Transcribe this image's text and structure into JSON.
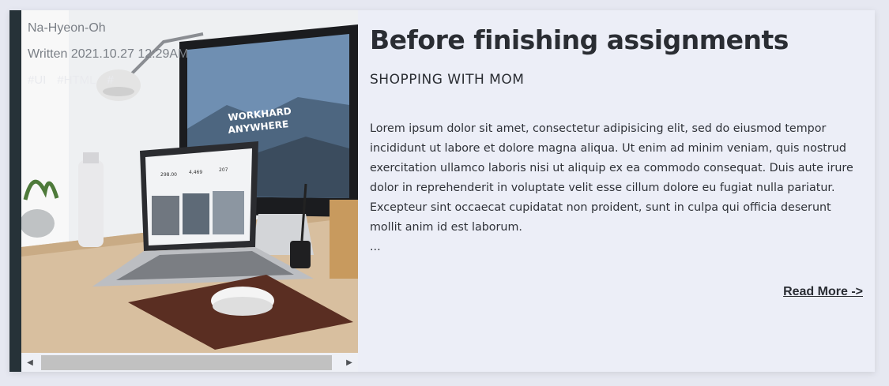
{
  "post": {
    "author": "Na-Hyeon-Oh",
    "written": "Written 2021.10.27 12:29AM",
    "tags": [
      "#UI",
      "#HTML",
      "#"
    ],
    "title": "Before finishing assignments",
    "subtitle": "SHOPPING WITH MOM",
    "body": "Lorem ipsum dolor sit amet, consectetur adipisicing elit, sed do eiusmod tempor incididunt ut labore et dolore magna aliqua. Ut enim ad minim veniam, quis nostrud exercitation ullamco laboris nisi ut aliquip ex ea commodo consequat. Duis aute irure dolor in reprehenderit in voluptate velit esse cillum dolore eu fugiat nulla pariatur. Excepteur sint occaecat cupidatat non proident, sunt in culpa qui officia deserunt mollit anim id est laborum.",
    "ellipsis": "...",
    "read_more": "Read More ->"
  },
  "image": {
    "monitor_text_line1": "WORKHARD",
    "monitor_text_line2": "ANYWHERE",
    "laptop_stats": [
      "298.00",
      "4,469",
      "207"
    ]
  },
  "scrollbar": {
    "left_arrow": "◀",
    "right_arrow": "▶"
  }
}
